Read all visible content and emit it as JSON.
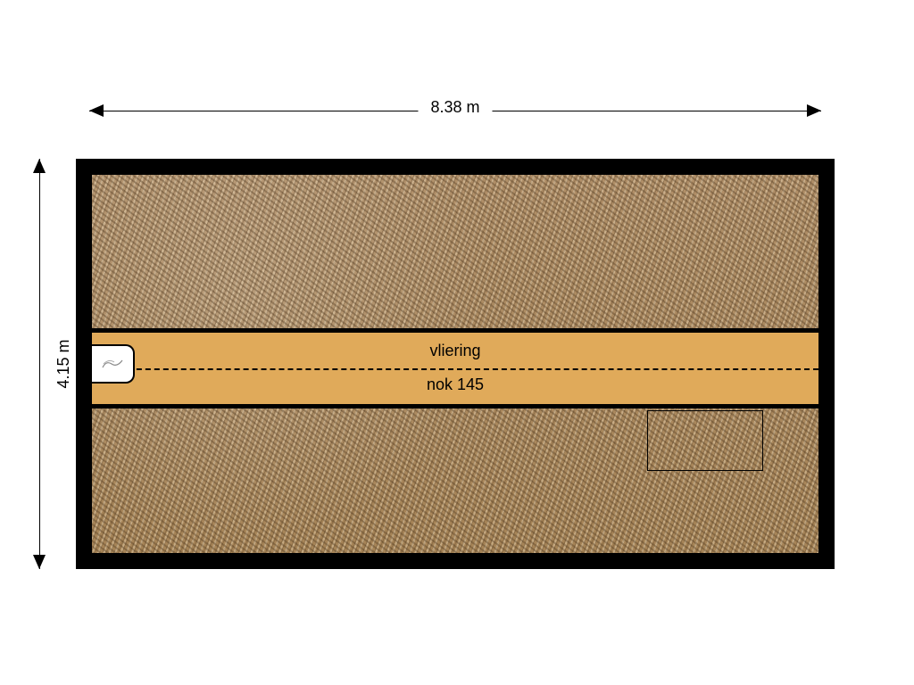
{
  "dimensions": {
    "width_label": "8.38 m",
    "height_label": "4.15 m"
  },
  "room": {
    "name": "vliering",
    "ridge_label": "nok 145"
  }
}
